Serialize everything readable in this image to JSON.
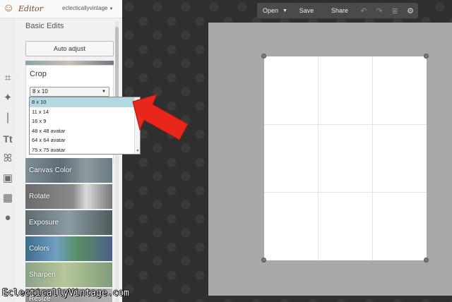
{
  "app": {
    "logo_text": "Editor",
    "user_menu": "eclecticallyvintage"
  },
  "toolbar": {
    "open_label": "Open",
    "save_label": "Save",
    "share_label": "Share"
  },
  "sidebar": {
    "section_title": "Basic Edits",
    "auto_adjust_label": "Auto adjust",
    "crop": {
      "title": "Crop",
      "selected_value": "8 x 10",
      "options": [
        "8 x 10",
        "11 x 14",
        "16 x 9",
        "48 x 48 avatar",
        "64 x 64 avatar",
        "75 x 75 avatar"
      ]
    },
    "tools": [
      {
        "label": "Canvas Color"
      },
      {
        "label": "Rotate"
      },
      {
        "label": "Exposure"
      },
      {
        "label": "Colors"
      },
      {
        "label": "Sharpen"
      },
      {
        "label": "Resize"
      }
    ],
    "rail_icons": [
      "crop-icon",
      "magic-wand-icon",
      "brush-icon",
      "text-icon",
      "butterfly-icon",
      "frame-icon",
      "texture-icon",
      "apple-icon"
    ]
  },
  "watermark": "EclecticallyVintage.com",
  "colors": {
    "selection_highlight": "#b0d9e1",
    "arrow": "#e8261a"
  }
}
